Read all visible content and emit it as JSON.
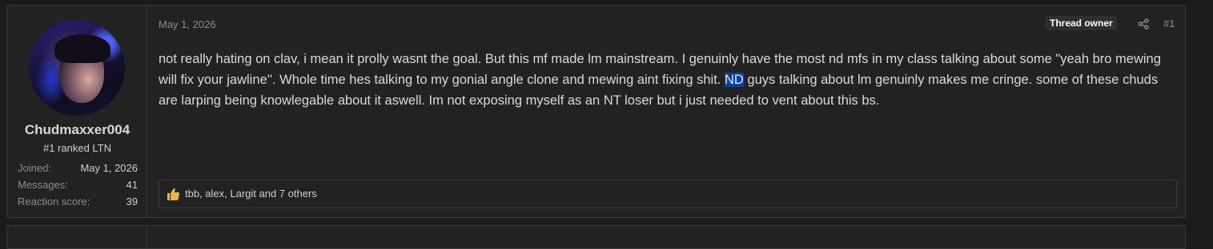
{
  "post": {
    "user": {
      "name": "Chudmaxxer004",
      "title": "#1 ranked LTN",
      "stats": [
        {
          "label": "Joined:",
          "value": "May 1, 2026"
        },
        {
          "label": "Messages:",
          "value": "41"
        },
        {
          "label": "Reaction score:",
          "value": "39"
        }
      ]
    },
    "date": "May 1, 2026",
    "badge": "Thread owner",
    "number": "#1",
    "body": {
      "before": "not really hating on clav, i mean it prolly wasnt the goal. But this mf made lm mainstream. I genuinly have the most nd mfs in my class talking about some \"yeah bro mewing will fix your jawline''. Whole time hes talking to my gonial angle clone and mewing aint fixing shit. ",
      "highlight": "ND",
      "after": " guys talking about lm genuinly makes me cringe. some of these chuds are larping being knowlegable about it aswell. Im not exposing myself as an NT loser but i just needed to vent about this bs."
    },
    "reactions": "tbb, alex, Largit and 7 others",
    "icons": {
      "share": "share-icon",
      "like": "thumbs-up-icon"
    },
    "colors": {
      "highlight": "#0a3fa3",
      "like": "#f0b53a"
    }
  }
}
